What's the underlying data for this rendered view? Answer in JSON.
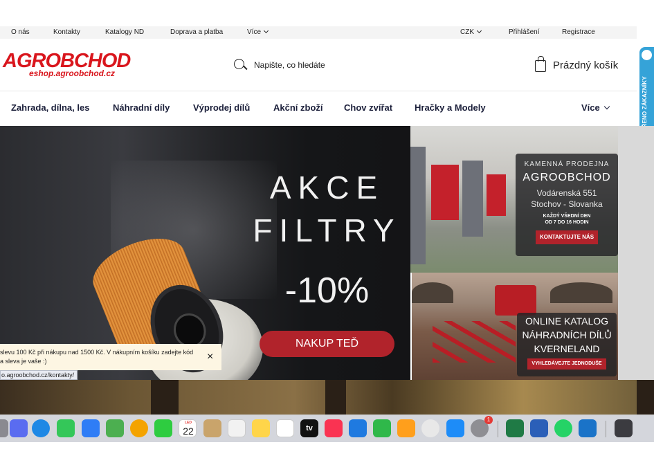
{
  "topbar": {
    "links": [
      "O nás",
      "Kontakty",
      "Katalogy ND",
      "Doprava a platba"
    ],
    "more": "Více",
    "currency": "CZK",
    "login": "Přihlášení",
    "register": "Registrace"
  },
  "header": {
    "logo_main": "AGROBCHOD",
    "logo_sub": "eshop.agroobchod.cz",
    "search_placeholder": "Napište, co hledáte",
    "cart_label": "Prázdný košík"
  },
  "nav": {
    "items": [
      "Zahrada, dílna, les",
      "Náhradní díly",
      "Výprodej dílů",
      "Akční zboží",
      "Chov zvířat",
      "Hračky a Modely"
    ],
    "more": "Více"
  },
  "badge": {
    "text": "OVĚŘENO ZÁKAZNÍKY"
  },
  "hero": {
    "line1": "AKCE",
    "line2": "FILTRY",
    "discount": "-10%",
    "button": "NAKUP TEĎ"
  },
  "shop_panel": {
    "label": "KAMENNÁ PRODEJNA",
    "name": "AGROOBCHOD",
    "street": "Vodárenská 551",
    "city": "Stochov - Slovanka",
    "hours1": "KAŽDÝ VŠEDNÍ DEN",
    "hours2": "OD 7 DO 16 HODIN",
    "button": "KONTAKTUJTE NÁS"
  },
  "catalog_panel": {
    "line1": "ONLINE KATALOG",
    "line2": "NÁHRADNÍCH DÍLŮ",
    "line3": "KVERNELAND",
    "button": "VYHLEDÁVEJTE JEDNODUŠE"
  },
  "toast": {
    "text": "slevu 100 Kč při nákupu nad 1500 Kč. V nákupním košíku zadejte kód a sleva je vaše :)",
    "close": "×"
  },
  "status_url": "o.agroobchod.cz/kontakty/",
  "dock": {
    "calendar_month": "LED",
    "calendar_day": "22",
    "tv_label": "tv",
    "settings_badge": "1",
    "colors": {
      "launchpad": "#5a6cf0",
      "safari": "#1e88e5",
      "messages": "#34c759",
      "mail": "#2f7df6",
      "maps": "#4caf50",
      "photos": "#f4a300",
      "facetime": "#2ecc40",
      "calendar": "#ffffff",
      "contacts": "#c9a46b",
      "reminders": "#f2f2f2",
      "notes": "#ffd54a",
      "freeform": "#ffffff",
      "appletv": "#111111",
      "music": "#fa3352",
      "keynote": "#1f7ae0",
      "numbers": "#2fb84a",
      "pages": "#ff9f1c",
      "chrome": "#e8e8e8",
      "appstore": "#1d8cf8",
      "settings": "#8e8e93",
      "excel": "#1f7a45",
      "word": "#2b5fb8",
      "whatsapp": "#25d366",
      "outlook": "#1a73c8",
      "finder": "#3b3b40"
    }
  }
}
